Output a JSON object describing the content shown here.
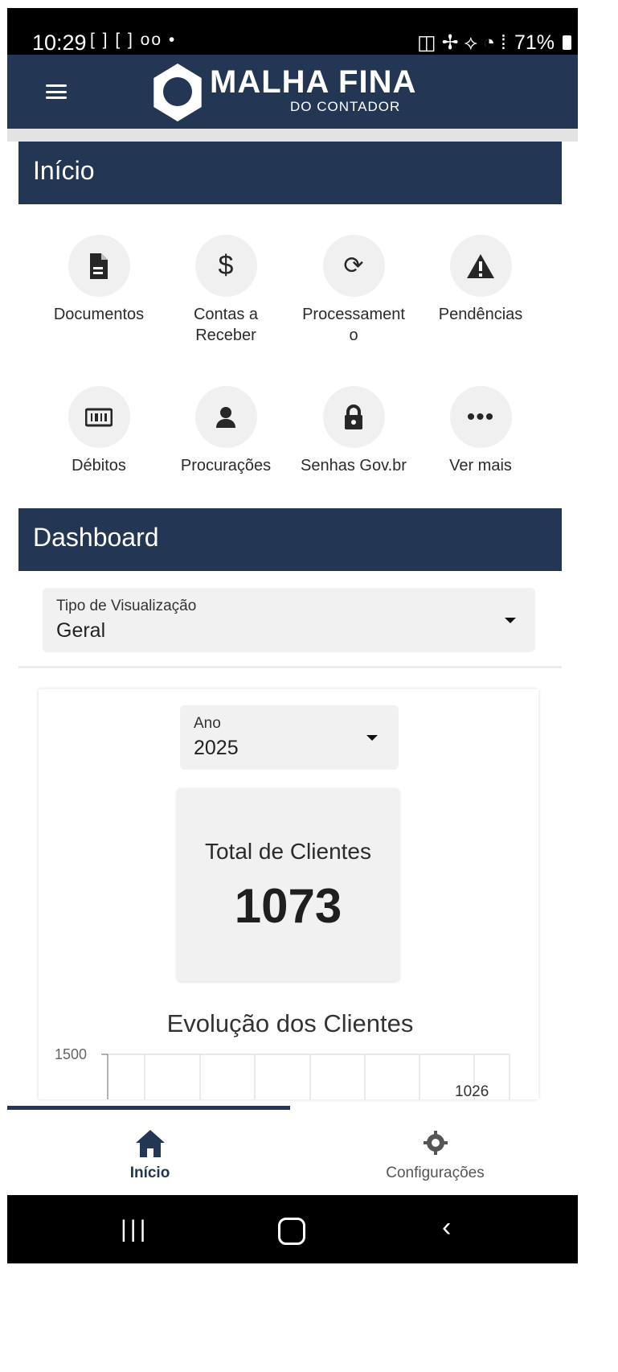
{
  "status_bar": {
    "time": "10:29",
    "left_icons": "[ ] [ ] oo •",
    "right_text": "71%"
  },
  "brand": {
    "title": "MALHA FINA",
    "subtitle": "DO CONTADOR",
    "primary_color": "#233754"
  },
  "inicio": {
    "title": "Início",
    "items": [
      {
        "label": "Documentos",
        "icon": "document-icon"
      },
      {
        "label": "Contas a Receber",
        "icon": "dollar-icon"
      },
      {
        "label": "Processament\no",
        "icon": "sync-icon"
      },
      {
        "label": "Pendências",
        "icon": "warning-icon"
      },
      {
        "label": "Débitos",
        "icon": "barcode-icon"
      },
      {
        "label": "Procurações",
        "icon": "person-icon"
      },
      {
        "label": "Senhas Gov.br",
        "icon": "lock-icon"
      },
      {
        "label": "Ver mais",
        "icon": "more-icon"
      }
    ]
  },
  "dashboard": {
    "title": "Dashboard",
    "view_type": {
      "label": "Tipo de Visualização",
      "value": "Geral"
    },
    "year": {
      "label": "Ano",
      "value": "2025"
    },
    "total_clients": {
      "label": "Total de Clientes",
      "value": "1073"
    },
    "chart_title": "Evolução dos Clientes"
  },
  "chart_data": {
    "type": "line",
    "title": "Evolução dos Clientes",
    "y_ticks": [
      "1500"
    ],
    "data_labels": [
      "1026"
    ],
    "ylim": [
      0,
      1500
    ],
    "grid": true
  },
  "bottom_nav": {
    "tabs": [
      {
        "label": "Início",
        "icon": "home-icon",
        "active": true
      },
      {
        "label": "Configurações",
        "icon": "gear-icon",
        "active": false
      }
    ]
  }
}
